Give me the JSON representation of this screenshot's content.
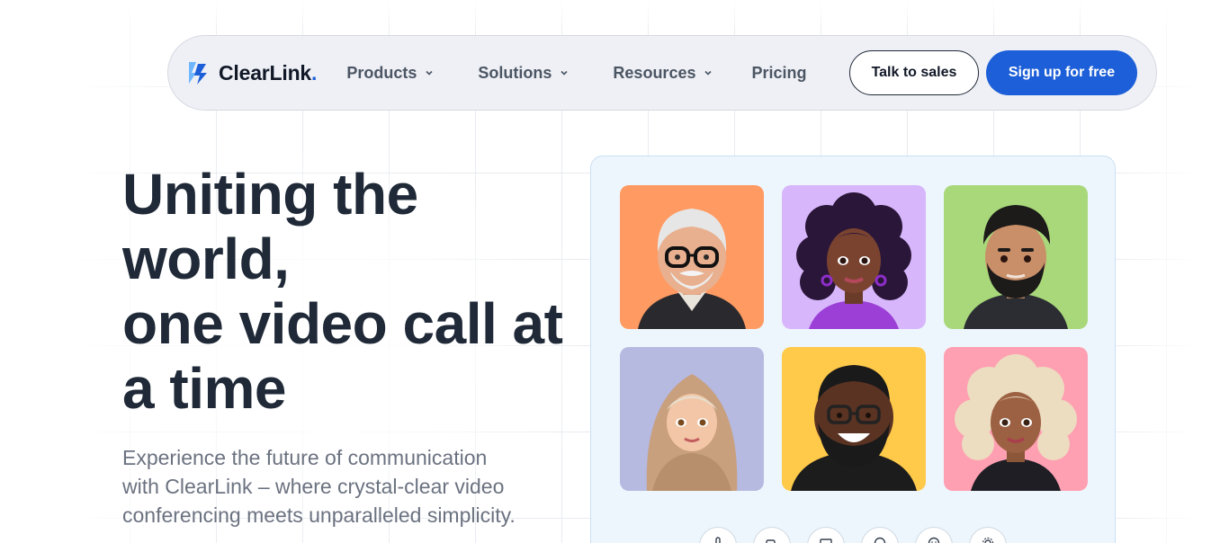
{
  "brand": {
    "name": "ClearLink",
    "dot": ".",
    "accent": "#1d5fd8"
  },
  "nav": {
    "items": [
      {
        "label": "Products",
        "has_menu": true
      },
      {
        "label": "Solutions",
        "has_menu": true
      },
      {
        "label": "Resources",
        "has_menu": true
      },
      {
        "label": "Pricing",
        "has_menu": false
      }
    ],
    "talk_to_sales": "Talk to sales",
    "sign_up": "Sign up for free"
  },
  "hero": {
    "headline_line1": "Uniting the",
    "headline_line2": "world,",
    "headline_line3": "one video call at",
    "headline_line4": "a time",
    "subtext_line1": "Experience the future of communication",
    "subtext_line2": "with ClearLink – where crystal-clear video",
    "subtext_line3": "conferencing meets unparalleled simplicity."
  },
  "call": {
    "participants": [
      {
        "avatar": "older-man-glasses-avatar",
        "bg": "#ff9a62"
      },
      {
        "avatar": "curly-hair-woman-avatar",
        "bg": "#d7b6fb"
      },
      {
        "avatar": "bearded-man-avatar",
        "bg": "#a8d87a"
      },
      {
        "avatar": "hijab-woman-avatar",
        "bg": "#b6b9e0"
      },
      {
        "avatar": "smiling-man-glasses-avatar",
        "bg": "#ffc94a"
      },
      {
        "avatar": "blonde-curly-woman-avatar",
        "bg": "#ff9fb2"
      }
    ],
    "controls": [
      "mic-icon",
      "video-icon",
      "screen-share-icon",
      "chat-icon",
      "reactions-icon",
      "settings-icon"
    ]
  }
}
